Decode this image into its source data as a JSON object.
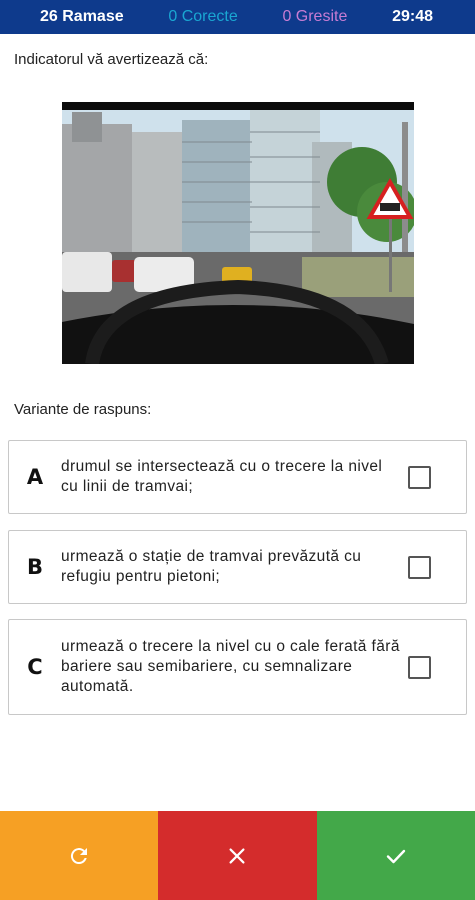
{
  "topbar": {
    "remaining": "26 Ramase",
    "correct": "0 Corecte",
    "wrong": "0 Gresite",
    "timer": "29:48"
  },
  "question": "Indicatorul vă avertizează că:",
  "image": {
    "description_icon": "road-photo-with-warning-sign"
  },
  "answers_label": "Variante de raspuns:",
  "options": [
    {
      "letter": "A",
      "text": "drumul se intersectează cu o trecere la nivel cu linii de tramvai;",
      "checked": false
    },
    {
      "letter": "B",
      "text": "urmează o stație de tramvai prevăzută cu refugiu pentru pietoni;",
      "checked": false
    },
    {
      "letter": "C",
      "text": "urmează o trecere la nivel cu o cale ferată fără bariere sau semibariere, cu semnalizare automată.",
      "checked": false
    }
  ],
  "bottom": {
    "reset_icon": "refresh-icon",
    "wrong_icon": "close-icon",
    "ok_icon": "check-icon",
    "colors": {
      "reset": "#f6a024",
      "wrong": "#d42c2c",
      "ok": "#43a849"
    }
  },
  "colors": {
    "topbar": "#0e3a8c",
    "correct": "#1aa6d2",
    "wrong": "#c67cd3"
  }
}
